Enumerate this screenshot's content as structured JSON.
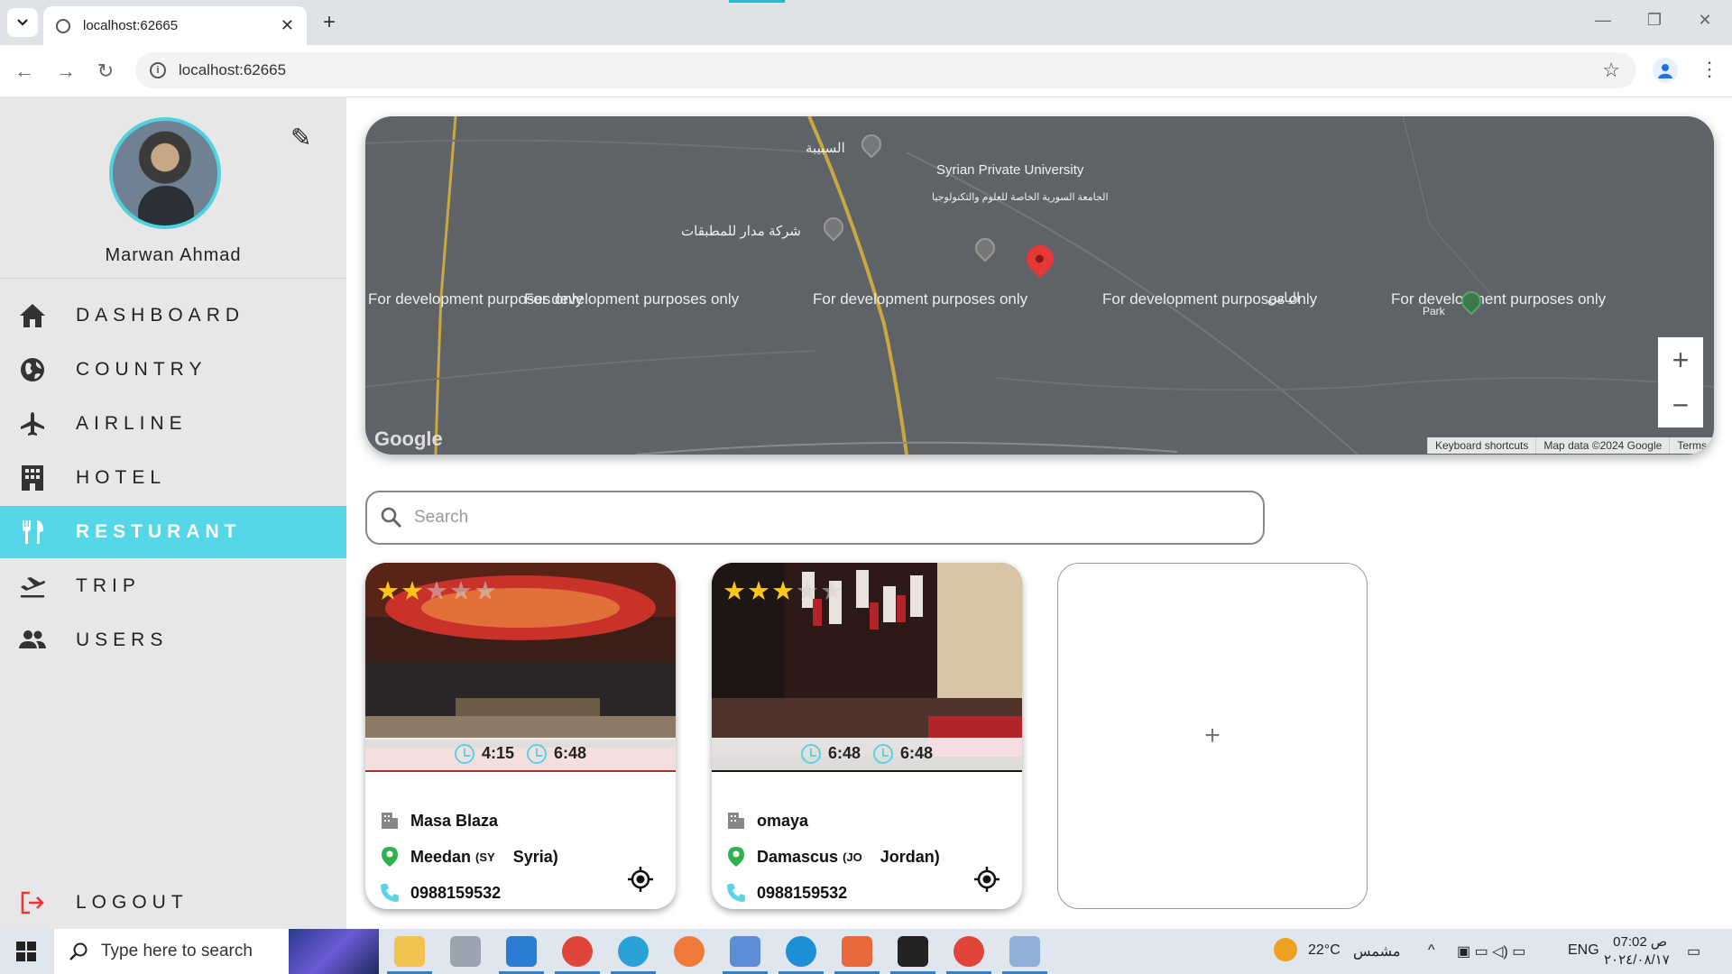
{
  "browser": {
    "tab_title": "localhost:62665",
    "url": "localhost:62665",
    "new_tab": "+",
    "close_tab": "✕"
  },
  "sidebar": {
    "profile_name": "Marwan Ahmad",
    "nav": [
      {
        "label": "DASHBOARD",
        "icon": "home-icon"
      },
      {
        "label": "COUNTRY",
        "icon": "globe-icon"
      },
      {
        "label": "AIRLINE",
        "icon": "airplane-icon"
      },
      {
        "label": "HOTEL",
        "icon": "building-icon"
      },
      {
        "label": "RESTURANT",
        "icon": "fork-knife-icon",
        "active": true
      },
      {
        "label": "TRIP",
        "icon": "takeoff-icon"
      },
      {
        "label": "USERS",
        "icon": "people-icon"
      }
    ],
    "logout": "LOGOUT"
  },
  "map": {
    "dev_text": "For development purposes only",
    "pois": [
      "السبيبة",
      "Syrian Private University",
      "الجامعة السورية الخاصة للعلوم والتكنولوجيا",
      "شركة مدار للمطبقات",
      "Park",
      "الياس"
    ],
    "zoom_in": "+",
    "zoom_out": "−",
    "logo": "Google",
    "footer": {
      "shortcuts": "Keyboard shortcuts",
      "data": "Map data ©2024 Google",
      "terms": "Terms"
    }
  },
  "search": {
    "placeholder": "Search",
    "value": ""
  },
  "restaurants": [
    {
      "name": "Masa Blaza",
      "city": "Meedan",
      "country_code": "(SY",
      "country": "Syria)",
      "phone": "0988159532",
      "open": "4:15",
      "close": "6:48",
      "rating": 2
    },
    {
      "name": "omaya",
      "city": "Damascus",
      "country_code": "(JO",
      "country": "Jordan)",
      "phone": "0988159532",
      "open": "6:48",
      "close": "6:48",
      "rating": 3
    }
  ],
  "add_card": "+",
  "taskbar": {
    "search": "Type here to search",
    "weather": "22°C",
    "weather_text": "مشمس",
    "lang": "ENG",
    "time": "07:02 ص",
    "date": "٢٠٢٤/٠٨/١٧"
  },
  "colors": {
    "accent": "#56d7e8",
    "star": "#ffc61a",
    "logout": "#e53935"
  }
}
